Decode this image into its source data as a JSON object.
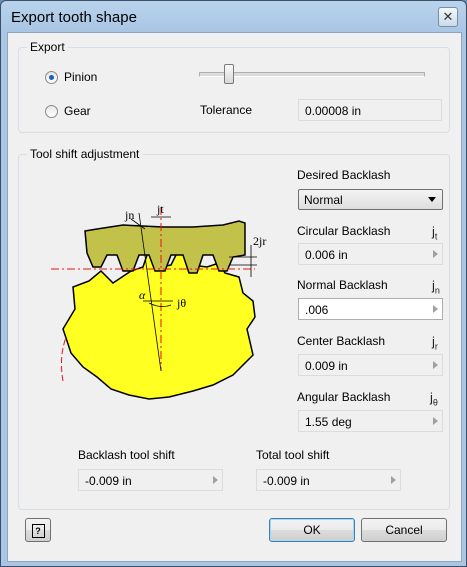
{
  "window": {
    "title": "Export tooth shape",
    "close_glyph": "✕"
  },
  "export": {
    "group_label": "Export",
    "pinion_label": "Pinion",
    "gear_label": "Gear",
    "selected": "Pinion",
    "tolerance_label": "Tolerance",
    "tolerance_value": "0.00008 in"
  },
  "tool_shift": {
    "group_label": "Tool shift adjustment",
    "desired_backlash": {
      "label": "Desired Backlash",
      "value": "Normal"
    },
    "circular_backlash": {
      "label": "Circular Backlash",
      "value": "0.006 in",
      "symbol": "j",
      "sub": "t"
    },
    "normal_backlash": {
      "label": "Normal Backlash",
      "value": ".006",
      "symbol": "j",
      "sub": "n"
    },
    "center_backlash": {
      "label": "Center Backlash",
      "value": "0.009 in",
      "symbol": "j",
      "sub": "r"
    },
    "angular_backlash": {
      "label": "Angular Backlash",
      "value": "1.55 deg",
      "symbol": "j",
      "sub": "θ"
    },
    "backlash_tool_shift": {
      "label": "Backlash tool shift",
      "value": "-0.009 in"
    },
    "total_tool_shift": {
      "label": "Total tool shift",
      "value": "-0.009 in"
    }
  },
  "diagram": {
    "labels": {
      "jn": "jn",
      "jt": "jt",
      "jr": "2jr",
      "alpha": "α",
      "jtheta": "jθ"
    },
    "colors": {
      "gear_fill": "#ffff22",
      "rack_fill": "#c2c24a",
      "pitch_line": "#e11",
      "outline": "#000"
    }
  },
  "buttons": {
    "ok": "OK",
    "cancel": "Cancel",
    "help_glyph": "?"
  },
  "colors": {
    "accent": "#1d5fbf",
    "dialog_bg": "#f0f0f0",
    "title_bg": "#b9d3ec"
  }
}
